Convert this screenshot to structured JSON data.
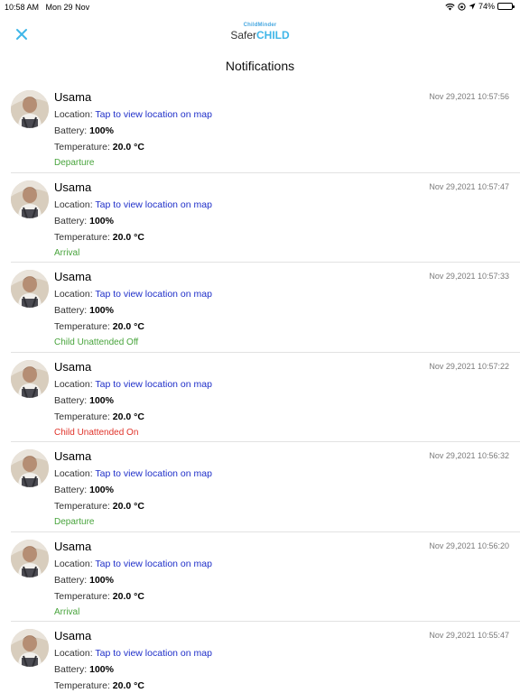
{
  "status_bar": {
    "time": "10:58 AM",
    "date": "Mon 29 Nov",
    "battery": "74%",
    "icons": [
      "wifi-icon",
      "orientation-lock-icon",
      "location-arrow-icon",
      "battery-icon"
    ]
  },
  "header": {
    "close_icon": "close-icon",
    "logo_top": "ChildMinder",
    "logo_main_prefix": "Safer",
    "logo_main_accent": "CHILD",
    "title": "Notifications"
  },
  "labels": {
    "location": "Location:",
    "battery": "Battery:",
    "temperature": "Temperature:",
    "location_link": "Tap to view location on map"
  },
  "colors": {
    "link": "#1f2fc9",
    "status_green": "#48a43c",
    "status_red": "#e0332a",
    "accent": "#3fb6e8"
  },
  "notifications": [
    {
      "name": "Usama",
      "timestamp": "Nov 29,2021 10:57:56",
      "battery": "100%",
      "temperature": "20.0 °C",
      "status": "Departure",
      "status_color": "green"
    },
    {
      "name": "Usama",
      "timestamp": "Nov 29,2021 10:57:47",
      "battery": "100%",
      "temperature": "20.0 °C",
      "status": "Arrival",
      "status_color": "green"
    },
    {
      "name": "Usama",
      "timestamp": "Nov 29,2021 10:57:33",
      "battery": "100%",
      "temperature": "20.0 °C",
      "status": "Child Unattended Off",
      "status_color": "green"
    },
    {
      "name": "Usama",
      "timestamp": "Nov 29,2021 10:57:22",
      "battery": "100%",
      "temperature": "20.0 °C",
      "status": "Child Unattended On",
      "status_color": "red"
    },
    {
      "name": "Usama",
      "timestamp": "Nov 29,2021 10:56:32",
      "battery": "100%",
      "temperature": "20.0 °C",
      "status": "Departure",
      "status_color": "green"
    },
    {
      "name": "Usama",
      "timestamp": "Nov 29,2021 10:56:20",
      "battery": "100%",
      "temperature": "20.0 °C",
      "status": "Arrival",
      "status_color": "green"
    },
    {
      "name": "Usama",
      "timestamp": "Nov 29,2021 10:55:47",
      "battery": "100%",
      "temperature": "20.0 °C",
      "status": "",
      "status_color": "green"
    }
  ]
}
